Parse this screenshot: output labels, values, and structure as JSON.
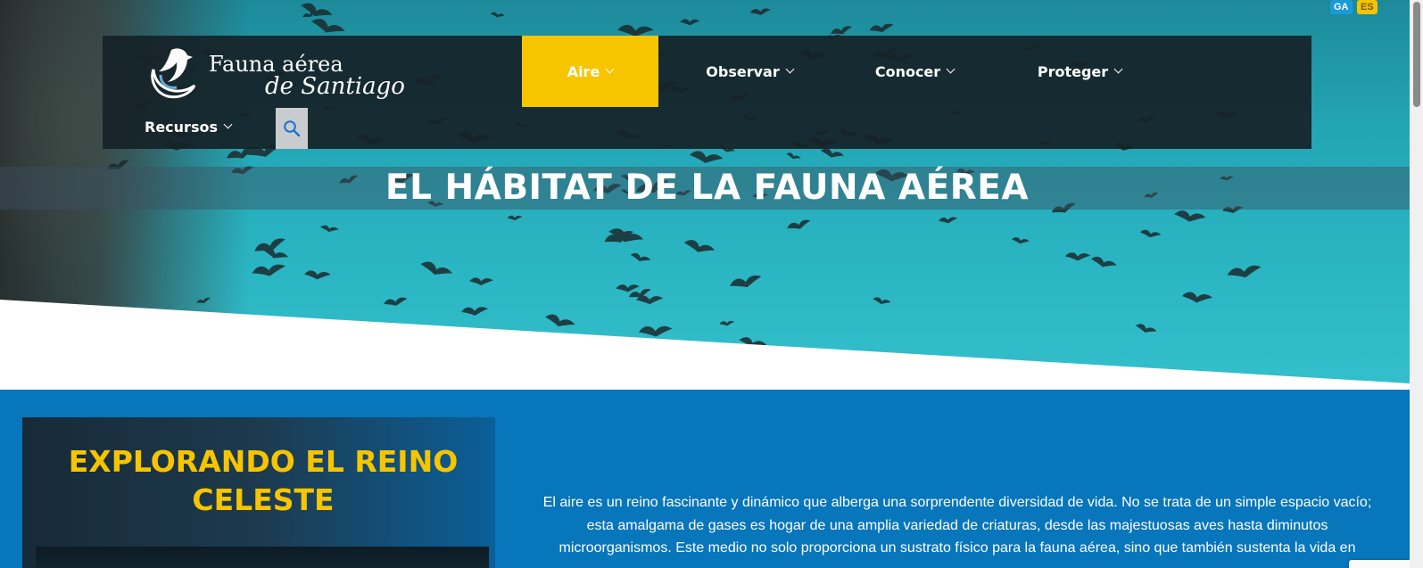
{
  "language_switcher": {
    "ga_label": "GA",
    "es_label": "ES"
  },
  "site": {
    "logo_line1": "Fauna aérea",
    "logo_line2": "de Santiago"
  },
  "nav": {
    "items": [
      {
        "label": "Aire",
        "active": true
      },
      {
        "label": "Observar",
        "active": false
      },
      {
        "label": "Conocer",
        "active": false
      },
      {
        "label": "Proteger",
        "active": false
      },
      {
        "label": "Recursos",
        "active": false
      }
    ],
    "search_icon": "search-icon",
    "active_color": "#f7c500"
  },
  "hero": {
    "title": "EL HÁBITAT DE LA FAUNA AÉREA"
  },
  "section": {
    "card_title": "EXPLORANDO EL REINO CELESTE",
    "intro_text": "El aire es un reino fascinante y dinámico que alberga una sorprendente diversidad de vida. No se trata de un simple espacio vacío; esta amalgama de gases es hogar de una amplia variedad de criaturas, desde las majestuosas aves hasta diminutos microorganismos. Este medio no solo proporciona un sustrato físico para la fauna aérea, sino que también sustenta la vida en"
  },
  "colors": {
    "accent_yellow": "#f7c500",
    "section_blue": "#0776bb",
    "nav_dark": "#162228"
  }
}
